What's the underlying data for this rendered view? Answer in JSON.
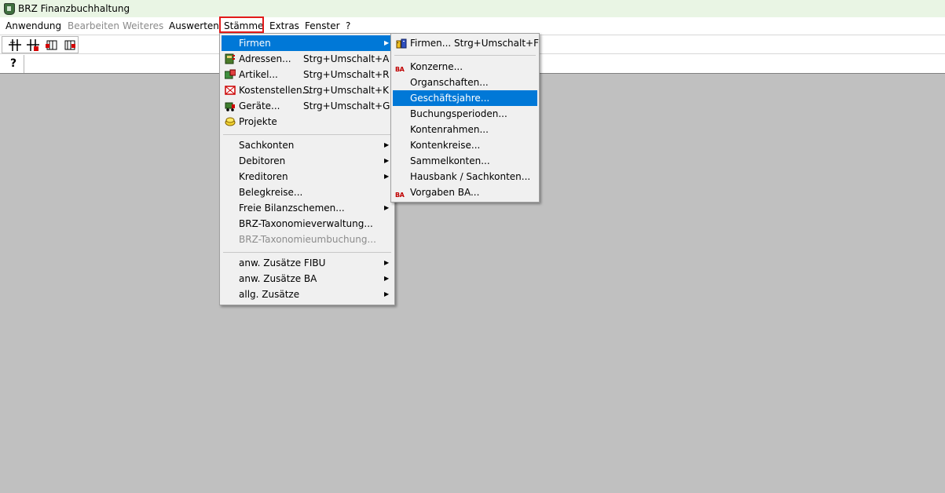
{
  "window": {
    "title": "BRZ Finanzbuchhaltung"
  },
  "menubar": {
    "items": [
      {
        "label": "Anwendung"
      },
      {
        "label": "Bearbeiten"
      },
      {
        "label": "Weiteres"
      },
      {
        "label": "Auswerten"
      },
      {
        "label": "Stämme"
      },
      {
        "label": "Extras"
      },
      {
        "label": "Fenster"
      },
      {
        "label": "?"
      }
    ]
  },
  "toolbar": {
    "help_glyph": "?"
  },
  "staemme_menu": {
    "items": [
      {
        "label": "Firmen"
      },
      {
        "label": "Adressen...",
        "shortcut": "Strg+Umschalt+A"
      },
      {
        "label": "Artikel...",
        "shortcut": "Strg+Umschalt+R"
      },
      {
        "label": "Kostenstellen...",
        "shortcut": "Strg+Umschalt+K"
      },
      {
        "label": "Geräte...",
        "shortcut": "Strg+Umschalt+G"
      },
      {
        "label": "Projekte"
      },
      {
        "label": "Sachkonten"
      },
      {
        "label": "Debitoren"
      },
      {
        "label": "Kreditoren"
      },
      {
        "label": "Belegkreise..."
      },
      {
        "label": "Freie Bilanzschemen..."
      },
      {
        "label": "BRZ-Taxonomieverwaltung..."
      },
      {
        "label": "BRZ-Taxonomieumbuchung..."
      },
      {
        "label": "anw. Zusätze FIBU"
      },
      {
        "label": "anw. Zusätze BA"
      },
      {
        "label": "allg. Zusätze"
      }
    ]
  },
  "firmen_submenu": {
    "items": [
      {
        "label": "Firmen... Strg+Umschalt+F"
      },
      {
        "label": "Konzerne..."
      },
      {
        "label": "Organschaften..."
      },
      {
        "label": "Geschäftsjahre..."
      },
      {
        "label": "Buchungsperioden..."
      },
      {
        "label": "Kontenrahmen..."
      },
      {
        "label": "Kontenkreise..."
      },
      {
        "label": "Sammelkonten..."
      },
      {
        "label": "Hausbank / Sachkonten..."
      },
      {
        "label": "Vorgaben BA..."
      }
    ],
    "ba_icon_text": "BA"
  },
  "colors": {
    "highlight": "#0078d7",
    "workspace": "#c0c0c0",
    "annotation": "#e21a1a"
  }
}
